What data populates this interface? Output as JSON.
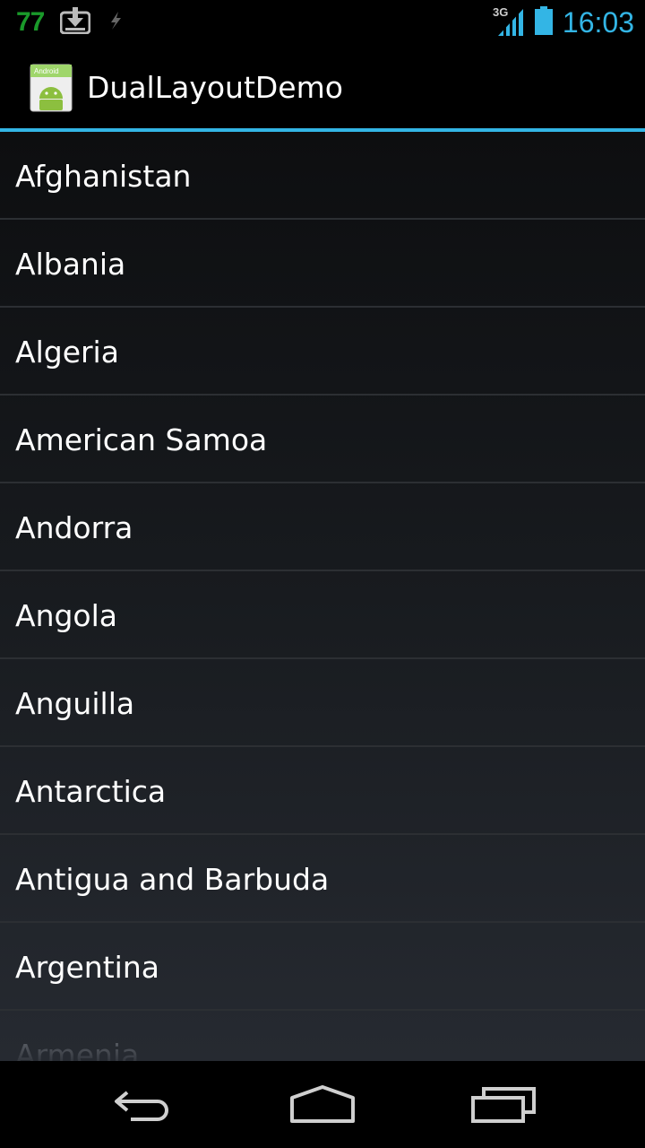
{
  "status_bar": {
    "notification_count": "77",
    "network_type": "3G",
    "time": "16:03",
    "icons": [
      "download-icon",
      "signal-bolt-icon",
      "cell-signal-icon",
      "battery-icon"
    ]
  },
  "action_bar": {
    "app_icon": "android-app-icon",
    "app_icon_label": "Android",
    "title": "DualLayoutDemo"
  },
  "list": {
    "items": [
      "Afghanistan",
      "Albania",
      "Algeria",
      "American Samoa",
      "Andorra",
      "Angola",
      "Anguilla",
      "Antarctica",
      "Antigua and Barbuda",
      "Argentina",
      "Armenia"
    ]
  },
  "nav_bar": {
    "icons": [
      "back-icon",
      "home-icon",
      "recent-apps-icon"
    ]
  },
  "colors": {
    "accent": "#33b5e5",
    "notification_green": "#1a9a2a",
    "background": "#000000"
  }
}
